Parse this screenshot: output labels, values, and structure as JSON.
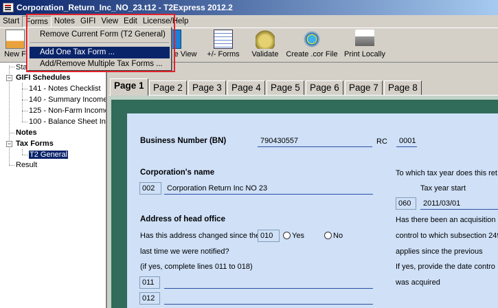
{
  "window": {
    "title": "Corporation_Return_Inc_NO_23.t12 - T2Express 2012.2"
  },
  "menubar": [
    "Start",
    "Forms",
    "Notes",
    "GIFI",
    "View",
    "Edit",
    "License/Help"
  ],
  "forms_menu": {
    "items": [
      "Remove Current Form (T2 General)",
      "Add One Tax Form ...",
      "Add/Remove Multiple Tax Forms ..."
    ],
    "highlighted": "Add One Tax Form ..."
  },
  "toolbar": {
    "new_label": "New F",
    "view_label": "e View",
    "forms_label": "+/- Forms",
    "validate_label": "Validate",
    "cor_label": "Create .cor File",
    "print_label": "Print Locally"
  },
  "tree": {
    "start": "Sta",
    "gifi_schedules": "GIFI Schedules",
    "gifi_items": [
      "141 - Notes Checklist",
      "140 - Summary Income",
      "125 - Non-Farm Income",
      "100 - Balance Sheet Inf"
    ],
    "notes": "Notes",
    "tax_forms": "Tax Forms",
    "t2_general": "T2 General",
    "result": "Result"
  },
  "tabs": [
    "Page 1",
    "Page 2",
    "Page 3",
    "Page 4",
    "Page 5",
    "Page 6",
    "Page 7",
    "Page 8"
  ],
  "form": {
    "bn_label": "Business Number (BN)",
    "bn_value": "790430557",
    "rc_label": "RC",
    "rc_value": "0001",
    "corp_name_label": "Corporation's name",
    "corp_name_code": "002",
    "corp_name_value": "Corporation Return Inc NO 23",
    "tax_year_question": "To which tax year does this ret",
    "tax_year_start_label": "Tax year start",
    "tax_year_start_code": "060",
    "tax_year_start_value": "2011/03/01",
    "address_label": "Address of head office",
    "address_changed_q": "Has this address changed since the",
    "address_changed_code": "010",
    "yes_label": "Yes",
    "no_label": "No",
    "last_time": "last time we were notified?",
    "if_yes": "(if yes, complete lines 011 to 018)",
    "line_011": "011",
    "line_012": "012",
    "acq_line1": "Has there been an acquisition c",
    "acq_line2": "control to which subsection 249",
    "acq_line3": "applies since the previous",
    "acq_line4": "If yes, provide the date contro",
    "acq_line5": "was acquired"
  }
}
